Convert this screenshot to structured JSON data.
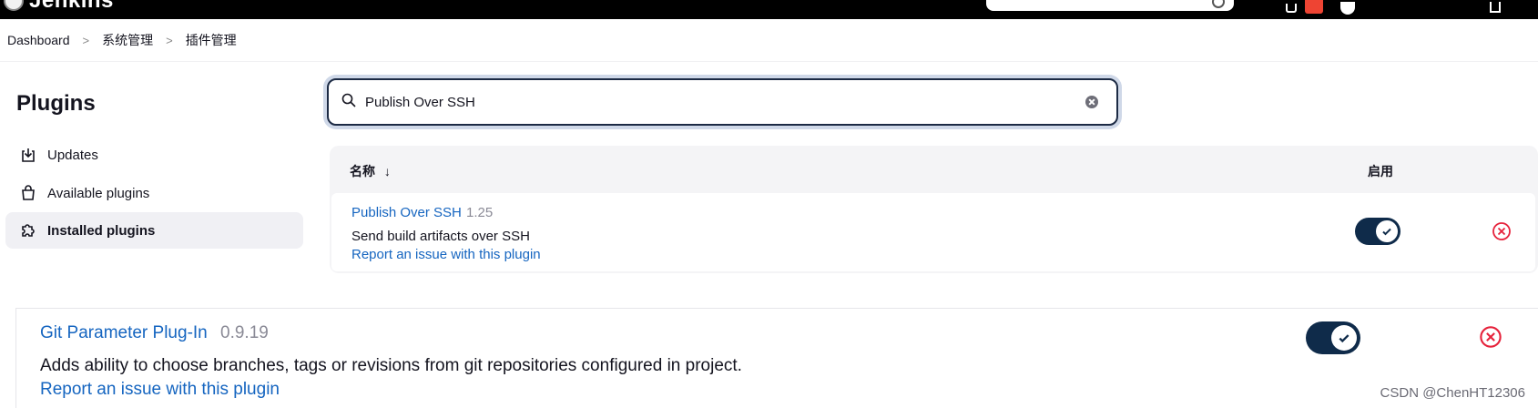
{
  "topbar": {
    "app_name": "Jenkins"
  },
  "breadcrumb": {
    "items": [
      "Dashboard",
      "系统管理",
      "插件管理"
    ],
    "separator": ">"
  },
  "sidebar": {
    "title": "Plugins",
    "items": [
      {
        "label": "Updates",
        "icon": "download-icon",
        "active": false
      },
      {
        "label": "Available plugins",
        "icon": "shopping-bag-icon",
        "active": false
      },
      {
        "label": "Installed plugins",
        "icon": "puzzle-icon",
        "active": true
      }
    ]
  },
  "search": {
    "value": "Publish Over SSH"
  },
  "table": {
    "col_name": "名称",
    "sort_indicator": "↓",
    "col_enabled": "启用",
    "rows": [
      {
        "name": "Publish Over SSH",
        "version": "1.25",
        "description": "Send build artifacts over SSH",
        "report_link": "Report an issue with this plugin",
        "enabled": true
      }
    ]
  },
  "lower_plugin": {
    "name": "Git Parameter Plug-In",
    "version": "0.9.19",
    "description": "Adds ability to choose branches, tags or revisions from git repositories configured in project.",
    "report_link": "Report an issue with this plugin",
    "enabled": true
  },
  "watermark": "CSDN @ChenHT12306",
  "colors": {
    "link": "#1565c0",
    "toggle_on": "#0f2b4a",
    "delete": "#e6223b",
    "topbar": "#000000"
  }
}
